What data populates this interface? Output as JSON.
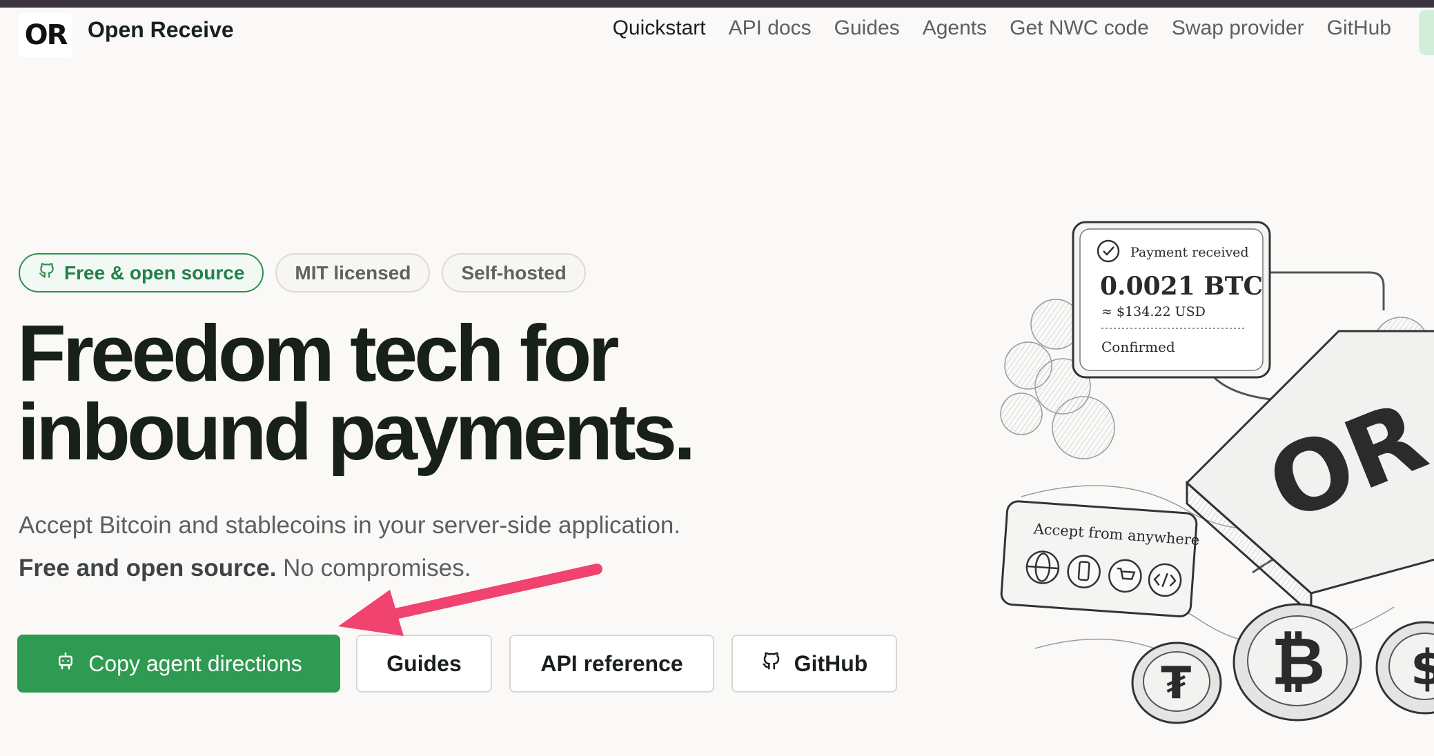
{
  "brand": {
    "logo_text": "OR",
    "name": "Open Receive"
  },
  "nav": {
    "items": [
      {
        "label": "Quickstart",
        "active": true
      },
      {
        "label": "API docs"
      },
      {
        "label": "Guides"
      },
      {
        "label": "Agents"
      },
      {
        "label": "Get NWC code"
      },
      {
        "label": "Swap provider"
      },
      {
        "label": "GitHub"
      }
    ]
  },
  "badges": [
    {
      "label": "Free & open source",
      "icon": "github-icon",
      "accent": "#2e8f4e"
    },
    {
      "label": "MIT licensed"
    },
    {
      "label": "Self-hosted"
    }
  ],
  "hero": {
    "title_line1": "Freedom tech for",
    "title_line2": "inbound payments.",
    "subtitle": "Accept Bitcoin and stablecoins in your server-side application.",
    "subtitle2_bold": "Free and open source.",
    "subtitle2_rest": " No compromises."
  },
  "buttons": {
    "copy_agent": {
      "label": "Copy agent directions",
      "icon": "robot-icon",
      "color": "#2f9a52"
    },
    "guides": {
      "label": "Guides"
    },
    "api_reference": {
      "label": "API reference"
    },
    "github": {
      "label": "GitHub",
      "icon": "github-icon"
    }
  },
  "annotation": {
    "arrow_color": "#f0436f"
  },
  "illustration": {
    "card_title": "Payment received",
    "amount": "0.0021 BTC",
    "fiat": "≈ $134.22 USD",
    "status": "Confirmed",
    "accept_title": "Accept from anywhere",
    "device_logo": "OR",
    "coin_symbols": [
      "₮",
      "₿",
      "$"
    ]
  }
}
